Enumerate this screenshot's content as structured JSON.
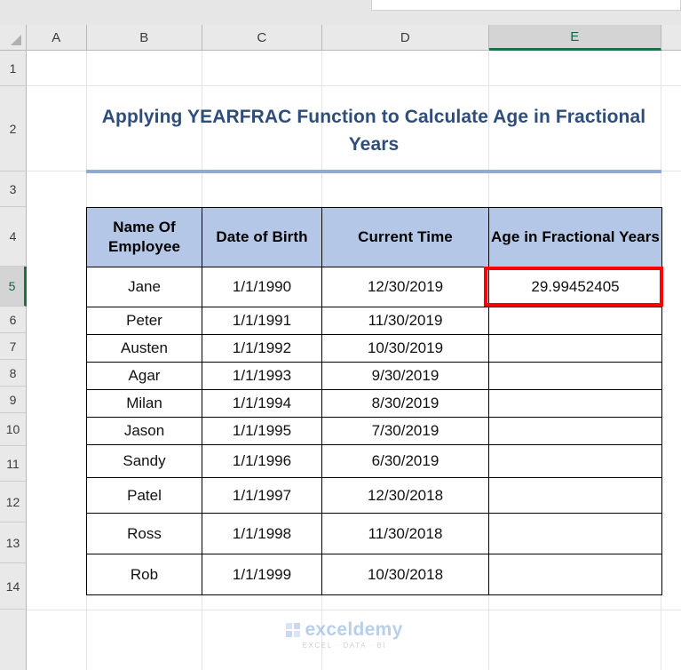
{
  "spreadsheet": {
    "column_headers": [
      "A",
      "B",
      "C",
      "D",
      "E"
    ],
    "selected_column": "E",
    "row_headers": [
      "1",
      "2",
      "3",
      "4",
      "5",
      "6",
      "7",
      "8",
      "9",
      "10",
      "11",
      "12",
      "13",
      "14"
    ],
    "selected_row": "5",
    "active_cell": "E5"
  },
  "title": {
    "text": "Applying YEARFRAC Function to Calculate Age in Fractional Years",
    "color": "#2E4D7B",
    "underline_color": "#8FA9D8"
  },
  "table": {
    "header_background": "#B4C7E7",
    "headers": [
      "Name Of Employee",
      "Date of Birth",
      "Current Time",
      "Age in Fractional Years"
    ],
    "rows": [
      {
        "name": "Jane",
        "dob": "1/1/1990",
        "current_time": "12/30/2019",
        "age": "29.99452405"
      },
      {
        "name": "Peter",
        "dob": "1/1/1991",
        "current_time": "11/30/2019",
        "age": ""
      },
      {
        "name": "Austen",
        "dob": "1/1/1992",
        "current_time": "10/30/2019",
        "age": ""
      },
      {
        "name": "Agar",
        "dob": "1/1/1993",
        "current_time": "9/30/2019",
        "age": ""
      },
      {
        "name": "Milan",
        "dob": "1/1/1994",
        "current_time": "8/30/2019",
        "age": ""
      },
      {
        "name": "Jason",
        "dob": "1/1/1995",
        "current_time": "7/30/2019",
        "age": ""
      },
      {
        "name": "Sandy",
        "dob": "1/1/1996",
        "current_time": "6/30/2019",
        "age": ""
      },
      {
        "name": "Patel",
        "dob": "1/1/1997",
        "current_time": "12/30/2018",
        "age": ""
      },
      {
        "name": "Ross",
        "dob": "1/1/1998",
        "current_time": "11/30/2018",
        "age": ""
      },
      {
        "name": "Rob",
        "dob": "1/1/1999",
        "current_time": "10/30/2018",
        "age": ""
      }
    ]
  },
  "highlight": {
    "cell": "E5",
    "color": "#FF0000"
  },
  "watermark": {
    "name": "exceldemy",
    "subtitle": "EXCEL · DATA · BI"
  }
}
